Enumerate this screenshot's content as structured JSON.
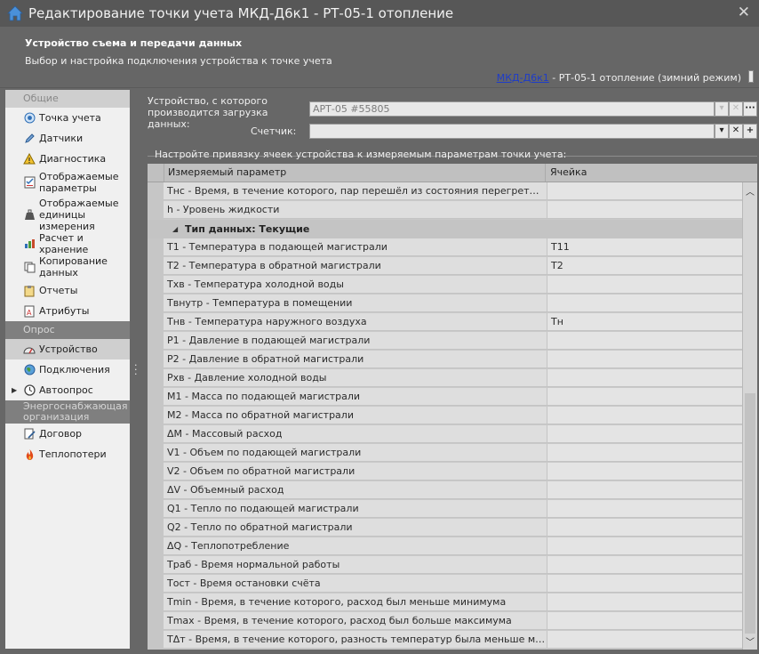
{
  "window": {
    "title": "Редактирование точки учета МКД-Д6к1 - РТ-05-1 отопление"
  },
  "header": {
    "title": "Устройство съема и передачи данных",
    "subtitle": "Выбор и настройка подключения устройства к точке учета",
    "breadcrumb_link": "МКД-Д6к1",
    "breadcrumb_rest": " - РТ-05-1 отопление (зимний режим)"
  },
  "sidebar": {
    "groups": [
      {
        "label": "Общие"
      },
      {
        "label": "Опрос"
      },
      {
        "label": "Энергоснабжающая организация"
      }
    ],
    "items": [
      {
        "label": "Точка учета",
        "icon": "target-icon"
      },
      {
        "label": "Датчики",
        "icon": "pencil-icon"
      },
      {
        "label": "Диагностика",
        "icon": "warning-icon"
      },
      {
        "label": "Отображаемые параметры",
        "icon": "checklist-icon"
      },
      {
        "label": "Отображаемые единицы измерения",
        "icon": "weight-icon"
      },
      {
        "label": "Расчет и хранение",
        "icon": "chart-icon"
      },
      {
        "label": "Копирование данных",
        "icon": "copy-icon"
      },
      {
        "label": "Отчеты",
        "icon": "clipboard-icon"
      },
      {
        "label": "Атрибуты",
        "icon": "document-icon"
      },
      {
        "label": "Устройство",
        "icon": "gauge-icon"
      },
      {
        "label": "Подключения",
        "icon": "globe-icon"
      },
      {
        "label": "Автоопрос",
        "icon": "clock-icon"
      },
      {
        "label": "Договор",
        "icon": "contract-icon"
      },
      {
        "label": "Теплопотери",
        "icon": "fire-icon"
      }
    ]
  },
  "form": {
    "device_label": "Устройство, с которого производится загрузка данных:",
    "device_value": "АРТ-05 #55805",
    "counter_label": "Счетчик:",
    "counter_value": "",
    "binding_title": "Настройте привязку ячеек устройства к измеряемым параметрам точки учета:"
  },
  "grid": {
    "col_param": "Измеряемый параметр",
    "col_cell": "Ячейка",
    "rows_before": [
      {
        "param": "Тнс - Время, в течение которого, пар перешёл из состояния перегретый в состо...",
        "cell": ""
      },
      {
        "param": "h - Уровень жидкости",
        "cell": ""
      }
    ],
    "group_label": "Тип данных: Текущие",
    "rows": [
      {
        "param": "T1 - Температура в подающей магистрали",
        "cell": "T11"
      },
      {
        "param": "T2 - Температура в обратной магистрали",
        "cell": "T2"
      },
      {
        "param": "Тхв - Температура холодной воды",
        "cell": ""
      },
      {
        "param": "Твнутр - Температура в помещении",
        "cell": ""
      },
      {
        "param": "Тнв - Температура наружного воздуха",
        "cell": "Тн"
      },
      {
        "param": "P1 - Давление в подающей магистрали",
        "cell": ""
      },
      {
        "param": "P2 - Давление в обратной магистрали",
        "cell": ""
      },
      {
        "param": "Pхв - Давление холодной воды",
        "cell": ""
      },
      {
        "param": "M1 - Масса по подающей магистрали",
        "cell": ""
      },
      {
        "param": "M2 - Масса по обратной магистрали",
        "cell": ""
      },
      {
        "param": "ΔM - Массовый расход",
        "cell": ""
      },
      {
        "param": "V1 - Объем по подающей магистрали",
        "cell": ""
      },
      {
        "param": "V2 - Объем по обратной магистрали",
        "cell": ""
      },
      {
        "param": "ΔV - Объемный расход",
        "cell": ""
      },
      {
        "param": "Q1 - Тепло по подающей магистрали",
        "cell": ""
      },
      {
        "param": "Q2 - Тепло по обратной магистрали",
        "cell": ""
      },
      {
        "param": "ΔQ - Теплопотребление",
        "cell": ""
      },
      {
        "param": "Траб - Время нормальной работы",
        "cell": ""
      },
      {
        "param": "Тост - Время остановки счёта",
        "cell": ""
      },
      {
        "param": "Tmin - Время, в течение которого, расход был меньше минимума",
        "cell": ""
      },
      {
        "param": "Tmax - Время, в течение которого, расход был больше максимума",
        "cell": ""
      },
      {
        "param": "TΔт - Время, в течение которого, разность температур была меньше минимума",
        "cell": ""
      }
    ]
  }
}
